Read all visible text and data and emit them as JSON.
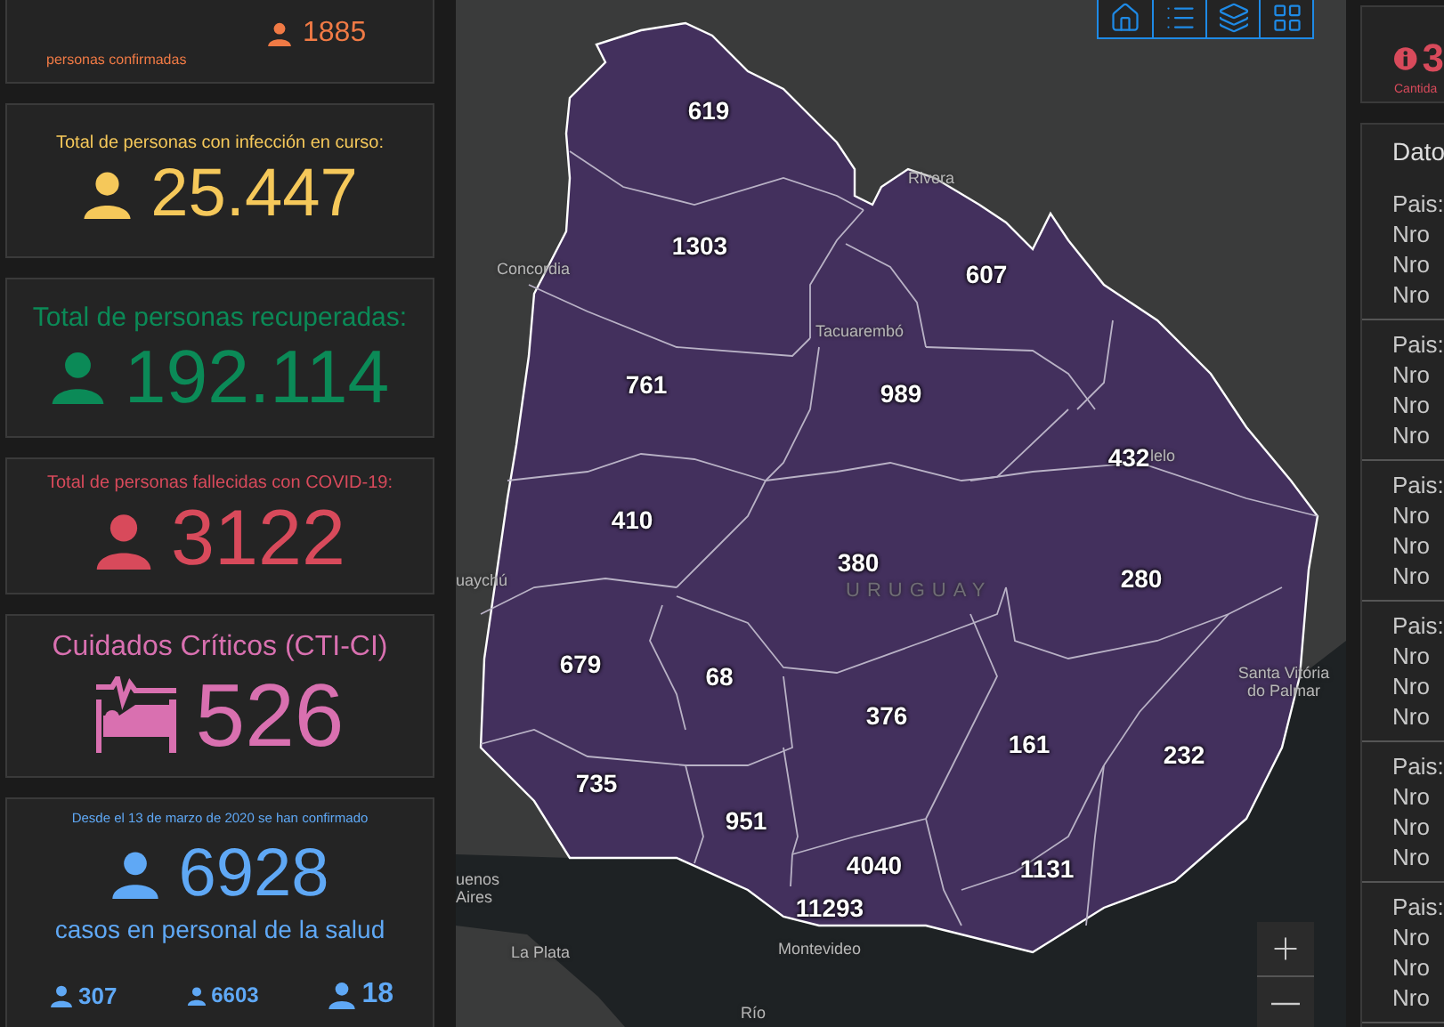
{
  "stat_cards": [
    {
      "kind": "cut",
      "value": "1885",
      "caption": "personas confirmadas",
      "color": "#f07a45"
    },
    {
      "kind": "person",
      "title": "Total de personas con infección en curso:",
      "value": "25.447",
      "color": "#f5c85a"
    },
    {
      "kind": "person",
      "title": "Total de personas recuperadas:",
      "value": "192.114",
      "color": "#0b8a57"
    },
    {
      "kind": "person",
      "title": "Total de personas fallecidas con COVID-19:",
      "value": "3122",
      "color": "#d84a5b"
    },
    {
      "kind": "bed",
      "title": "Cuidados Críticos (CTI-CI)",
      "value": "526",
      "color": "#d970b0"
    },
    {
      "kind": "health",
      "title": "Desde el 13 de marzo de 2020 se han confirmado",
      "value": "6928",
      "caption": "casos en personal de la salud",
      "breakdown": [
        "307",
        "6603",
        "18"
      ],
      "color": "#5fa8f5"
    }
  ],
  "map": {
    "departments": [
      "619",
      "1303",
      "607",
      "761",
      "989",
      "432",
      "410",
      "380",
      "280",
      "679",
      "68",
      "376",
      "161",
      "232",
      "735",
      "951",
      "4040",
      "1131",
      "11293"
    ],
    "places": [
      "Rivera",
      "Concordia",
      "Tacuarembó",
      "lelo",
      "uaychú",
      "URUGUAY",
      "Santa Vitória do Palmar",
      "uenos Aires",
      "La Plata",
      "Montevideo",
      "Río"
    ]
  },
  "alert": {
    "value": "3",
    "caption": "Cantida"
  },
  "datos": {
    "title": "Dato",
    "groups": [
      [
        "Pais:",
        "Nro",
        "Nro",
        "Nro"
      ],
      [
        "Pais:",
        "Nro",
        "Nro",
        "Nro"
      ],
      [
        "Pais:",
        "Nro",
        "Nro",
        "Nro"
      ],
      [
        "Pais:",
        "Nro",
        "Nro",
        "Nro"
      ],
      [
        "Pais:",
        "Nro",
        "Nro",
        "Nro"
      ],
      [
        "Pais:",
        "Nro",
        "Nro",
        "Nro"
      ]
    ]
  }
}
